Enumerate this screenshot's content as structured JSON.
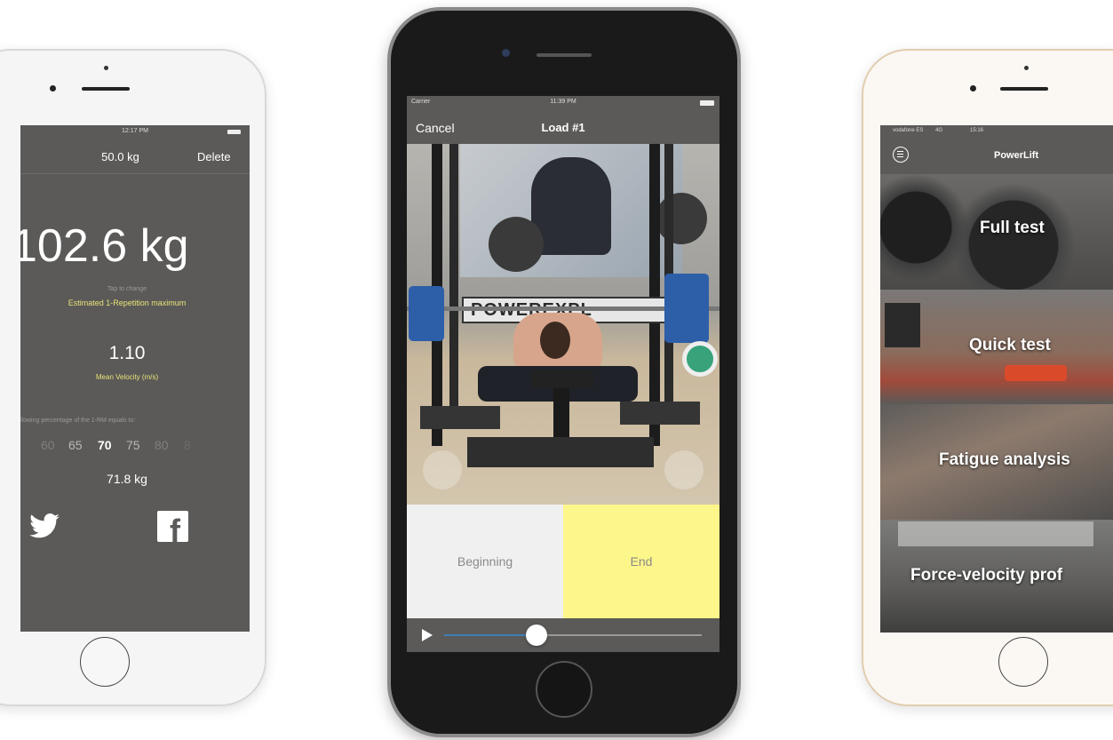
{
  "left_phone": {
    "status_time": "12:17 PM",
    "nav_title": "50.0 kg",
    "nav_action": "Delete",
    "big_weight": "102.6 kg",
    "tap_hint": "Tap to change",
    "estimated_label": "Estimated 1-Repetition maximum",
    "velocity_value": "1.10",
    "velocity_label": "Mean Velocity (m/s)",
    "percentage_text": "llowing percentage of the 1-RM equals to:",
    "percentages": [
      "60",
      "65",
      "70",
      "75",
      "80",
      "8"
    ],
    "selected_percentage": "70",
    "result_weight": "71.8 kg",
    "share_icons": [
      "twitter-icon",
      "facebook-icon"
    ],
    "accent_color": "#e8e27a",
    "screen_color": "#5b5a58"
  },
  "middle_phone": {
    "status_carrier": "Carrier",
    "status_time": "11:39 PM",
    "nav_cancel": "Cancel",
    "nav_title": "Load #1",
    "brand_banner": "POWEREXPL",
    "beginning_label": "Beginning",
    "end_label": "End",
    "playback_progress": 0.36,
    "end_color": "#fdf68a",
    "slider_color": "#3f7fb6"
  },
  "right_phone": {
    "status_carrier": "vodafone ES",
    "status_network": "4G",
    "status_time": "15:16",
    "nav_title": "PowerLift",
    "menu_items": [
      {
        "label": "Full test"
      },
      {
        "label": "Quick test"
      },
      {
        "label": "Fatigue analysis"
      },
      {
        "label": "Force-velocity prof"
      }
    ]
  }
}
